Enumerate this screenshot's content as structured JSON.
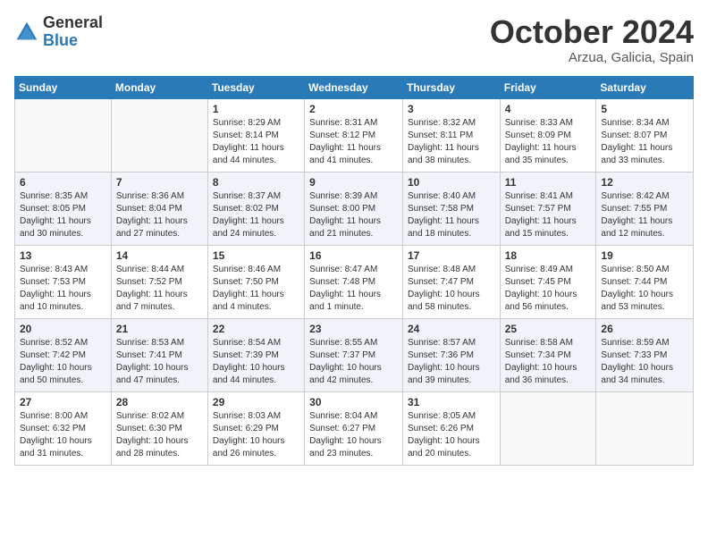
{
  "header": {
    "logo_general": "General",
    "logo_blue": "Blue",
    "month": "October 2024",
    "location": "Arzua, Galicia, Spain"
  },
  "days_of_week": [
    "Sunday",
    "Monday",
    "Tuesday",
    "Wednesday",
    "Thursday",
    "Friday",
    "Saturday"
  ],
  "weeks": [
    [
      {
        "day": "",
        "info": ""
      },
      {
        "day": "",
        "info": ""
      },
      {
        "day": "1",
        "info": "Sunrise: 8:29 AM\nSunset: 8:14 PM\nDaylight: 11 hours and 44 minutes."
      },
      {
        "day": "2",
        "info": "Sunrise: 8:31 AM\nSunset: 8:12 PM\nDaylight: 11 hours and 41 minutes."
      },
      {
        "day": "3",
        "info": "Sunrise: 8:32 AM\nSunset: 8:11 PM\nDaylight: 11 hours and 38 minutes."
      },
      {
        "day": "4",
        "info": "Sunrise: 8:33 AM\nSunset: 8:09 PM\nDaylight: 11 hours and 35 minutes."
      },
      {
        "day": "5",
        "info": "Sunrise: 8:34 AM\nSunset: 8:07 PM\nDaylight: 11 hours and 33 minutes."
      }
    ],
    [
      {
        "day": "6",
        "info": "Sunrise: 8:35 AM\nSunset: 8:05 PM\nDaylight: 11 hours and 30 minutes."
      },
      {
        "day": "7",
        "info": "Sunrise: 8:36 AM\nSunset: 8:04 PM\nDaylight: 11 hours and 27 minutes."
      },
      {
        "day": "8",
        "info": "Sunrise: 8:37 AM\nSunset: 8:02 PM\nDaylight: 11 hours and 24 minutes."
      },
      {
        "day": "9",
        "info": "Sunrise: 8:39 AM\nSunset: 8:00 PM\nDaylight: 11 hours and 21 minutes."
      },
      {
        "day": "10",
        "info": "Sunrise: 8:40 AM\nSunset: 7:58 PM\nDaylight: 11 hours and 18 minutes."
      },
      {
        "day": "11",
        "info": "Sunrise: 8:41 AM\nSunset: 7:57 PM\nDaylight: 11 hours and 15 minutes."
      },
      {
        "day": "12",
        "info": "Sunrise: 8:42 AM\nSunset: 7:55 PM\nDaylight: 11 hours and 12 minutes."
      }
    ],
    [
      {
        "day": "13",
        "info": "Sunrise: 8:43 AM\nSunset: 7:53 PM\nDaylight: 11 hours and 10 minutes."
      },
      {
        "day": "14",
        "info": "Sunrise: 8:44 AM\nSunset: 7:52 PM\nDaylight: 11 hours and 7 minutes."
      },
      {
        "day": "15",
        "info": "Sunrise: 8:46 AM\nSunset: 7:50 PM\nDaylight: 11 hours and 4 minutes."
      },
      {
        "day": "16",
        "info": "Sunrise: 8:47 AM\nSunset: 7:48 PM\nDaylight: 11 hours and 1 minute."
      },
      {
        "day": "17",
        "info": "Sunrise: 8:48 AM\nSunset: 7:47 PM\nDaylight: 10 hours and 58 minutes."
      },
      {
        "day": "18",
        "info": "Sunrise: 8:49 AM\nSunset: 7:45 PM\nDaylight: 10 hours and 56 minutes."
      },
      {
        "day": "19",
        "info": "Sunrise: 8:50 AM\nSunset: 7:44 PM\nDaylight: 10 hours and 53 minutes."
      }
    ],
    [
      {
        "day": "20",
        "info": "Sunrise: 8:52 AM\nSunset: 7:42 PM\nDaylight: 10 hours and 50 minutes."
      },
      {
        "day": "21",
        "info": "Sunrise: 8:53 AM\nSunset: 7:41 PM\nDaylight: 10 hours and 47 minutes."
      },
      {
        "day": "22",
        "info": "Sunrise: 8:54 AM\nSunset: 7:39 PM\nDaylight: 10 hours and 44 minutes."
      },
      {
        "day": "23",
        "info": "Sunrise: 8:55 AM\nSunset: 7:37 PM\nDaylight: 10 hours and 42 minutes."
      },
      {
        "day": "24",
        "info": "Sunrise: 8:57 AM\nSunset: 7:36 PM\nDaylight: 10 hours and 39 minutes."
      },
      {
        "day": "25",
        "info": "Sunrise: 8:58 AM\nSunset: 7:34 PM\nDaylight: 10 hours and 36 minutes."
      },
      {
        "day": "26",
        "info": "Sunrise: 8:59 AM\nSunset: 7:33 PM\nDaylight: 10 hours and 34 minutes."
      }
    ],
    [
      {
        "day": "27",
        "info": "Sunrise: 8:00 AM\nSunset: 6:32 PM\nDaylight: 10 hours and 31 minutes."
      },
      {
        "day": "28",
        "info": "Sunrise: 8:02 AM\nSunset: 6:30 PM\nDaylight: 10 hours and 28 minutes."
      },
      {
        "day": "29",
        "info": "Sunrise: 8:03 AM\nSunset: 6:29 PM\nDaylight: 10 hours and 26 minutes."
      },
      {
        "day": "30",
        "info": "Sunrise: 8:04 AM\nSunset: 6:27 PM\nDaylight: 10 hours and 23 minutes."
      },
      {
        "day": "31",
        "info": "Sunrise: 8:05 AM\nSunset: 6:26 PM\nDaylight: 10 hours and 20 minutes."
      },
      {
        "day": "",
        "info": ""
      },
      {
        "day": "",
        "info": ""
      }
    ]
  ]
}
